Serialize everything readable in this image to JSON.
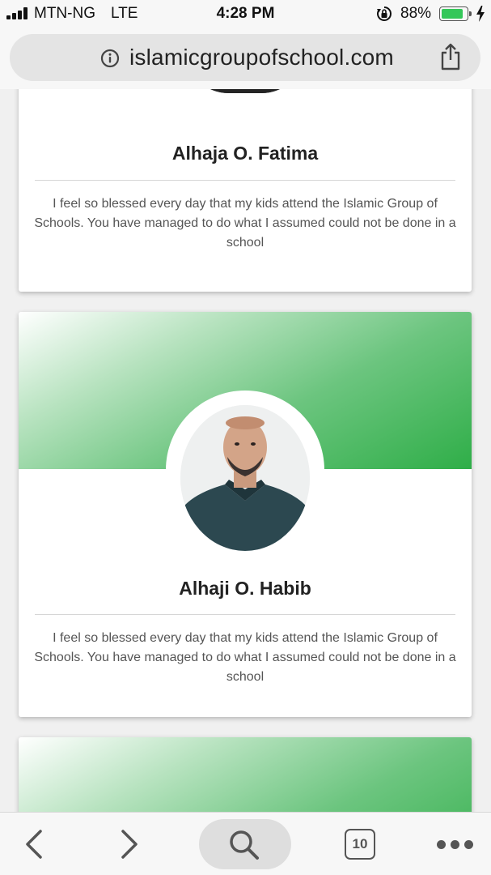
{
  "status_bar": {
    "carrier": "MTN-NG",
    "network": "LTE",
    "time": "4:28 PM",
    "battery_percent": "88%",
    "battery_level": 0.88,
    "battery_color": "#34c759",
    "icons": [
      "signal-icon",
      "orientation-lock-icon",
      "battery-icon",
      "charging-bolt-icon"
    ]
  },
  "browser": {
    "url": "islamicgroupofschool.com",
    "info_icon": "info-icon",
    "share_icon": "share-icon"
  },
  "testimonials": [
    {
      "name": "Alhaja O. Fatima",
      "text": "I feel so blessed every day that my kids attend the Islamic Group of Schools. You have managed to do what I assumed could not be done in a school"
    },
    {
      "name": "Alhaji O. Habib",
      "text": "I feel so blessed every day that my kids attend the Islamic Group of Schools. You have managed to do what I assumed could not be done in a school"
    }
  ],
  "theme": {
    "accent_green": "#2fae48",
    "banner_light": "#b8e3c0"
  },
  "toolbar": {
    "tab_count": "10",
    "icons": [
      "back-icon",
      "forward-icon",
      "search-icon",
      "tabs-icon",
      "more-icon"
    ]
  }
}
